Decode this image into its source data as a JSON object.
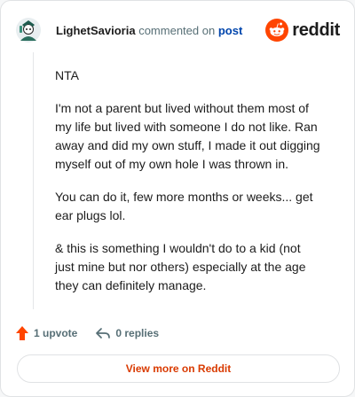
{
  "comment": {
    "username": "LighetSavioria",
    "action_text": "commented on",
    "link_text": "post",
    "paragraphs": [
      "NTA",
      "I'm not a parent but lived without them most of my life but lived with someone I do not like. Ran away and did my own stuff, I made it out digging myself out of my own hole I was thrown in.",
      "You can do it, few more months or weeks... get ear plugs lol.",
      "& this is something I wouldn't do to a kid (not just mine but nor others) especially at the age they can definitely manage."
    ]
  },
  "brand": {
    "name": "reddit",
    "color": "#ff4500"
  },
  "actions": {
    "upvotes": "1 upvote",
    "replies": "0 replies"
  },
  "footer": {
    "view_more": "View more on Reddit"
  },
  "icons": {
    "avatar": "snoo-avatar",
    "logo": "reddit-snoo-icon",
    "upvote": "upvote-arrow-icon",
    "reply": "reply-arrow-icon"
  }
}
